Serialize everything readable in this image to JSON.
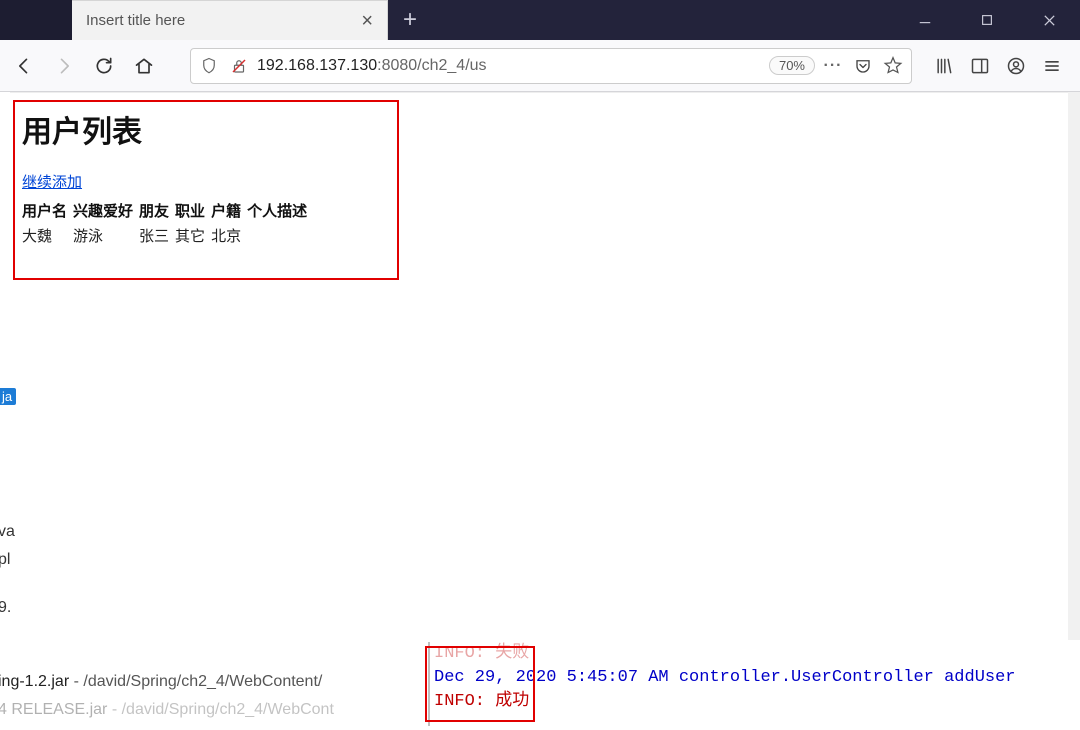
{
  "window": {
    "tab_title": "Insert title here"
  },
  "url": {
    "host_pre": "192.168.137.130",
    "host_port_path": ":8080/ch2_4/us",
    "zoom": "70%"
  },
  "page": {
    "heading": "用户列表",
    "add_link": "继续添加",
    "headers": {
      "username": "用户名",
      "hobby": "兴趣爱好",
      "friend": "朋友",
      "job": "职业",
      "residence": "户籍",
      "description": "个人描述"
    },
    "rows": [
      {
        "username": "大魏",
        "hobby": "游泳",
        "friend": "张三",
        "job": "其它",
        "residence": "北京",
        "description": ""
      }
    ]
  },
  "ide_left": {
    "badge": "ja",
    "lines": [
      "va",
      "pl",
      " ",
      "9."
    ]
  },
  "ide_bottom_left": {
    "line1_dark": "ing-1.2.jar",
    "line1_rest": " - /david/Spring/ch2_4/WebContent/",
    "line2_dark": "4 RELEASE.jar",
    "line2_rest": " - /david/Spring/ch2_4/WebCont"
  },
  "console": {
    "l1": "INFO: 失败",
    "l2_blue": "Dec 29, 2020 5:45:07 AM controller.UserController addUser",
    "l3": "INFO: 成功"
  }
}
